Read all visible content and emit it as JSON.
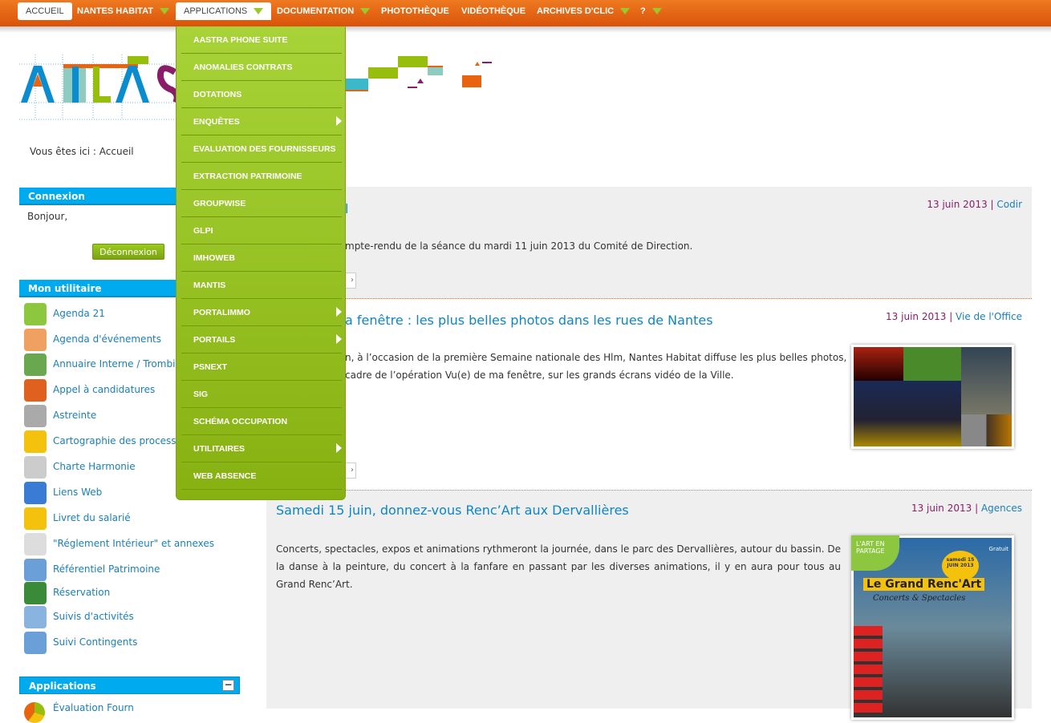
{
  "nav": {
    "items": [
      {
        "label": "ACCUEIL",
        "dropdown": false,
        "selected": true
      },
      {
        "label": "NANTES HABITAT",
        "dropdown": true
      },
      {
        "label": "APPLICATIONS",
        "dropdown": true,
        "open": true
      },
      {
        "label": "DOCUMENTATION",
        "dropdown": true
      },
      {
        "label": "PHOTOTHÈQUE",
        "dropdown": false
      },
      {
        "label": "VIDÉOTHÈQUE",
        "dropdown": false
      },
      {
        "label": "ARCHIVES D'CLIC",
        "dropdown": true
      },
      {
        "label": "?",
        "dropdown": true
      }
    ],
    "colors": {
      "bar": "#e8640f",
      "accent": "#9bc92a"
    }
  },
  "logo": {
    "text": "ATLAS"
  },
  "breadcrumb": "Vous êtes ici : Accueil",
  "applications_menu": [
    {
      "label": "AASTRA PHONE SUITE"
    },
    {
      "label": "ANOMALIES CONTRATS"
    },
    {
      "label": "DOTATIONS"
    },
    {
      "label": "ENQUÊTES",
      "submenu": true
    },
    {
      "label": "EVALUATION DES FOURNISSEURS"
    },
    {
      "label": "EXTRACTION PATRIMOINE"
    },
    {
      "label": "GROUPWISE"
    },
    {
      "label": "GLPI"
    },
    {
      "label": "IMHOWEB"
    },
    {
      "label": "MANTIS"
    },
    {
      "label": "PORTALIMMO",
      "submenu": true
    },
    {
      "label": "PORTAILS",
      "submenu": true
    },
    {
      "label": "PSNEXT"
    },
    {
      "label": "SIG"
    },
    {
      "label": "SCHÉMA OCCUPATION"
    },
    {
      "label": "UTILITAIRES",
      "submenu": true
    },
    {
      "label": "WEB ABSENCE"
    }
  ],
  "connexion": {
    "title": "Connexion",
    "greeting": "Bonjour,",
    "logout": "Déconnexion"
  },
  "utilitaire": {
    "title": "Mon utilitaire",
    "items": [
      {
        "label": "Agenda 21",
        "icon": "recycle-tag-icon"
      },
      {
        "label": "Agenda d'événements",
        "icon": "calendar-icon"
      },
      {
        "label": "Annuaire Interne / Trombin",
        "icon": "users-icon"
      },
      {
        "label": "Appel à candidatures",
        "icon": "person-icon"
      },
      {
        "label": "Astreinte",
        "icon": "phone-icon"
      },
      {
        "label": "Cartographie des processus",
        "icon": "notebook-icon"
      },
      {
        "label": "Charte Harmonie",
        "icon": "document-pen-icon"
      },
      {
        "label": "Liens Web",
        "icon": "globe-icon"
      },
      {
        "label": "Livret du salarié",
        "icon": "notebook-icon"
      },
      {
        "label": "\"Réglement Intérieur\" et annexes",
        "icon": "document-icon"
      },
      {
        "label": "Référentiel Patrimoine",
        "icon": "building-icon"
      },
      {
        "label": "Réservation",
        "icon": "clock-calendar-icon"
      },
      {
        "label": "Suivis d'activités",
        "icon": "chart-icon"
      },
      {
        "label": "Suivi Contingents",
        "icon": "building-icon"
      }
    ]
  },
  "applications_box": {
    "title": "Applications",
    "first_item": "Évaluation Fourn"
  },
  "articles": [
    {
      "date": "13 juin 2013",
      "category": "Codir",
      "title_fragment": "l",
      "text": [
        "mpte-rendu de la séance du mardi 11 juin 2013 du Comité de Direction."
      ]
    },
    {
      "date": "13 juin 2013",
      "category": "Vie de l'Office",
      "title_fragment": "a fenêtre : les plus belles photos dans les rues de Nantes",
      "text": [
        "n, à l’occasion de la première Semaine nationale des Hlm, Nantes Habitat diffuse les plus belles photos,",
        "cadre de l’opération Vu(e) de ma fenêtre, sur les grands écrans vidéo de la Ville."
      ]
    },
    {
      "date": "13 juin 2013",
      "category": "Agences",
      "title": "Samedi 15 juin, donnez-vous Renc’Art aux Dervallières",
      "text": [
        "Concerts, spectacles, expos et animations rythmeront la journée, dans le parc des Dervallières, autour du bassin. De la",
        "danse à la peinture, du concert à la fanfare en passant par les diverses animations, il y en aura pour tous au Grand",
        "Renc’Art."
      ],
      "poster": {
        "tag": "L'ART EN PARTAGE",
        "date": "samedi 15 JUIN 2013",
        "title": "Le Grand Renc'Art",
        "subtitle": "Concerts & Spectacles",
        "badge": "Gratuit"
      }
    }
  ]
}
